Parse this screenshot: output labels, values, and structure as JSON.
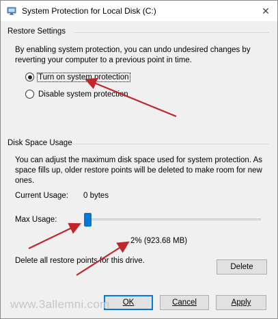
{
  "window": {
    "title": "System Protection for Local Disk (C:)",
    "close_glyph": "✕"
  },
  "restore": {
    "section_label": "Restore Settings",
    "description": "By enabling system protection, you can undo undesired changes by reverting your computer to a previous point in time.",
    "options": [
      {
        "label": "Turn on system protection",
        "checked": true
      },
      {
        "label": "Disable system protection",
        "checked": false
      }
    ]
  },
  "disk": {
    "section_label": "Disk Space Usage",
    "description": "You can adjust the maximum disk space used for system protection. As space fills up, older restore points will be deleted to make room for new ones.",
    "current_usage_label": "Current Usage:",
    "current_usage_value": "0 bytes",
    "max_usage_label": "Max Usage:",
    "max_usage_percent": 2,
    "max_usage_text": "2% (923.68 MB)",
    "delete_text": "Delete all restore points for this drive.",
    "delete_button": "Delete"
  },
  "footer": {
    "ok": "OK",
    "cancel": "Cancel",
    "apply": "Apply"
  },
  "watermark": "www.3allemni.com",
  "colors": {
    "accent": "#0078d7",
    "annotation_arrow": "#c0272d"
  }
}
